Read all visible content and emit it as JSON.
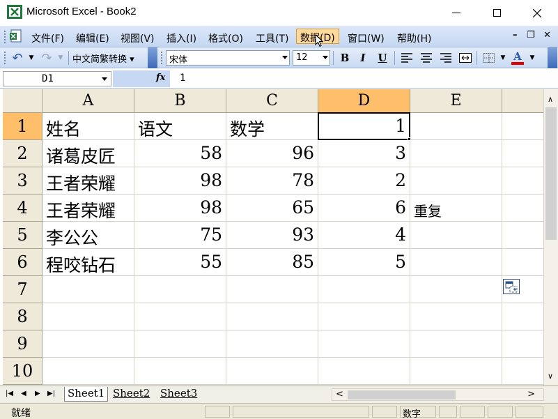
{
  "window": {
    "title": "Microsoft Excel - Book2",
    "minimize": "─",
    "maximize": "☐",
    "close": "✕"
  },
  "menu": {
    "items": [
      "文件(F)",
      "编辑(E)",
      "视图(V)",
      "插入(I)",
      "格式(O)",
      "工具(T)",
      "数据(D)",
      "窗口(W)",
      "帮助(H)"
    ],
    "active": "数据(D)",
    "controls": [
      "–",
      "❐",
      "✕"
    ]
  },
  "toolbar": {
    "undo_icon": "↶",
    "redo_icon": "↷",
    "convert_label": "中文简繁转换 ▾",
    "font_name": "宋体",
    "font_size": "12",
    "bold": "B",
    "italic": "I",
    "underline": "U",
    "font_color_letter": "A",
    "accent_red": "#e00000"
  },
  "formula_bar": {
    "name_box": "D1",
    "fx_label": "fx",
    "value": "1"
  },
  "grid": {
    "columns": [
      "A",
      "B",
      "C",
      "D",
      "E"
    ],
    "rows": [
      "1",
      "2",
      "3",
      "4",
      "5",
      "6",
      "7",
      "8",
      "9",
      "10"
    ],
    "selected_column": "D",
    "selected_row": "1",
    "cells": [
      [
        "姓名",
        "语文",
        "数学",
        "1",
        ""
      ],
      [
        "诸葛皮匠",
        "58",
        "96",
        "3",
        ""
      ],
      [
        "王者荣耀",
        "98",
        "78",
        "2",
        ""
      ],
      [
        "王者荣耀",
        "98",
        "65",
        "6",
        "重复"
      ],
      [
        "李公公",
        "75",
        "93",
        "4",
        ""
      ],
      [
        "程咬钻石",
        "55",
        "85",
        "5",
        ""
      ]
    ]
  },
  "sheets": {
    "tabs": [
      "Sheet1",
      "Sheet2",
      "Sheet3"
    ],
    "active": "Sheet1",
    "nav": [
      "|◀",
      "◀",
      "▶",
      "▶|"
    ],
    "scroll_left": "<",
    "scroll_right": ">"
  },
  "status": {
    "ready": "就绪",
    "mode": "数字"
  },
  "colors": {
    "header_bg": "#efe9d9",
    "selected_header": "#ffbe6a",
    "menu_active": "#ffd99b",
    "excel_green": "#1d7a3a"
  }
}
